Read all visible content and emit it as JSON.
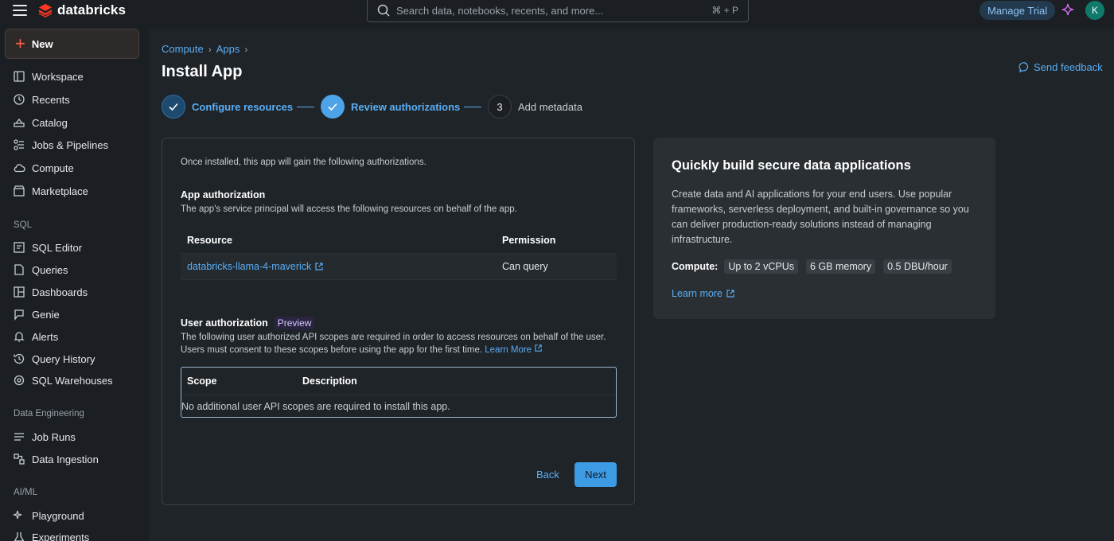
{
  "topbar": {
    "brand": "databricks",
    "search_placeholder": "Search data, notebooks, recents, and more...",
    "search_shortcut": "⌘ + P",
    "manage_trial": "Manage Trial",
    "avatar_initial": "K"
  },
  "sidebar": {
    "new_label": "New",
    "items": [
      {
        "label": "Workspace"
      },
      {
        "label": "Recents"
      },
      {
        "label": "Catalog"
      },
      {
        "label": "Jobs & Pipelines"
      },
      {
        "label": "Compute"
      },
      {
        "label": "Marketplace"
      }
    ],
    "sql_section": "SQL",
    "sql_items": [
      {
        "label": "SQL Editor"
      },
      {
        "label": "Queries"
      },
      {
        "label": "Dashboards"
      },
      {
        "label": "Genie"
      },
      {
        "label": "Alerts"
      },
      {
        "label": "Query History"
      },
      {
        "label": "SQL Warehouses"
      }
    ],
    "de_section": "Data Engineering",
    "de_items": [
      {
        "label": "Job Runs"
      },
      {
        "label": "Data Ingestion"
      }
    ],
    "ai_section": "AI/ML",
    "ai_items": [
      {
        "label": "Playground"
      },
      {
        "label": "Experiments"
      }
    ]
  },
  "breadcrumb": [
    "Compute",
    "Apps"
  ],
  "page_title": "Install App",
  "send_feedback": "Send feedback",
  "stepper": [
    {
      "label": "Configure resources",
      "status": "done"
    },
    {
      "label": "Review authorizations",
      "status": "current"
    },
    {
      "number": "3",
      "label": "Add metadata",
      "status": "pending"
    }
  ],
  "auth_card": {
    "intro": "Once installed, this app will gain the following authorizations.",
    "app_auth_title": "App authorization",
    "app_auth_desc": "The app's service principal will access the following resources on behalf of the app.",
    "resource_header": "Resource",
    "permission_header": "Permission",
    "resources": [
      {
        "name": "databricks-llama-4-maverick",
        "permission": "Can query"
      }
    ],
    "user_auth_title": "User authorization",
    "preview_badge": "Preview",
    "user_auth_desc": "The following user authorized API scopes are required in order to access resources on behalf of the user. Users must consent to these scopes before using the app for the first time.",
    "learn_more": "Learn More",
    "scope_header": "Scope",
    "description_header": "Description",
    "scope_empty": "No additional user API scopes are required to install this app.",
    "back_label": "Back",
    "next_label": "Next"
  },
  "info_card": {
    "title": "Quickly build secure data applications",
    "desc": "Create data and AI applications for your end users. Use popular frameworks, serverless deployment, and built-in governance so you can deliver production-ready solutions instead of managing infrastructure.",
    "compute_label": "Compute:",
    "chips": [
      "Up to 2 vCPUs",
      "6 GB memory",
      "0.5 DBU/hour"
    ],
    "learn_more": "Learn more"
  },
  "colors": {
    "accent": "#5aaef5",
    "brand": "#ff3621",
    "background": "#1f2429"
  }
}
